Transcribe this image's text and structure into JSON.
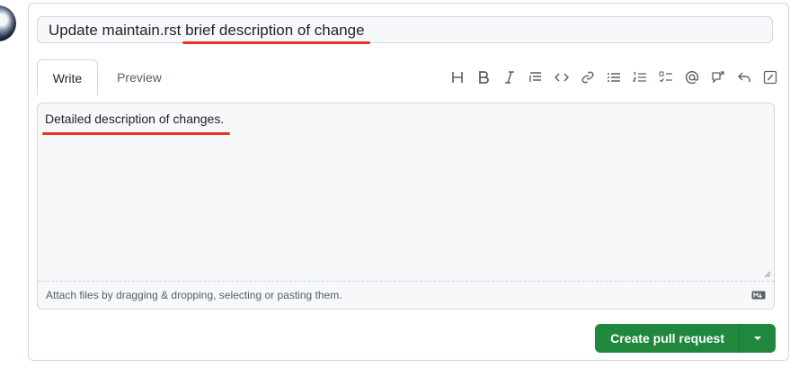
{
  "pull_request": {
    "title_prefix": "Update maintain.rst",
    "title_highlight": "brief description of change"
  },
  "tabs": {
    "write_label": "Write",
    "preview_label": "Preview"
  },
  "toolbar": {
    "icons": [
      "heading-icon",
      "bold-icon",
      "italic-icon",
      "quote-icon",
      "code-icon",
      "link-icon",
      "bulleted-list-icon",
      "numbered-list-icon",
      "task-list-icon",
      "mention-icon",
      "cross-reference-icon",
      "reply-icon",
      "slash-command-icon"
    ]
  },
  "editor": {
    "body_text": "Detailed description of changes.",
    "attach_hint": "Attach files by dragging & dropping, selecting or pasting them."
  },
  "actions": {
    "create_label": "Create pull request"
  },
  "colors": {
    "primary_green": "#1f883d",
    "annotation_red": "#ea3323",
    "border": "#d0d7de",
    "muted_text": "#57606a",
    "input_bg": "#f6f8fa"
  }
}
